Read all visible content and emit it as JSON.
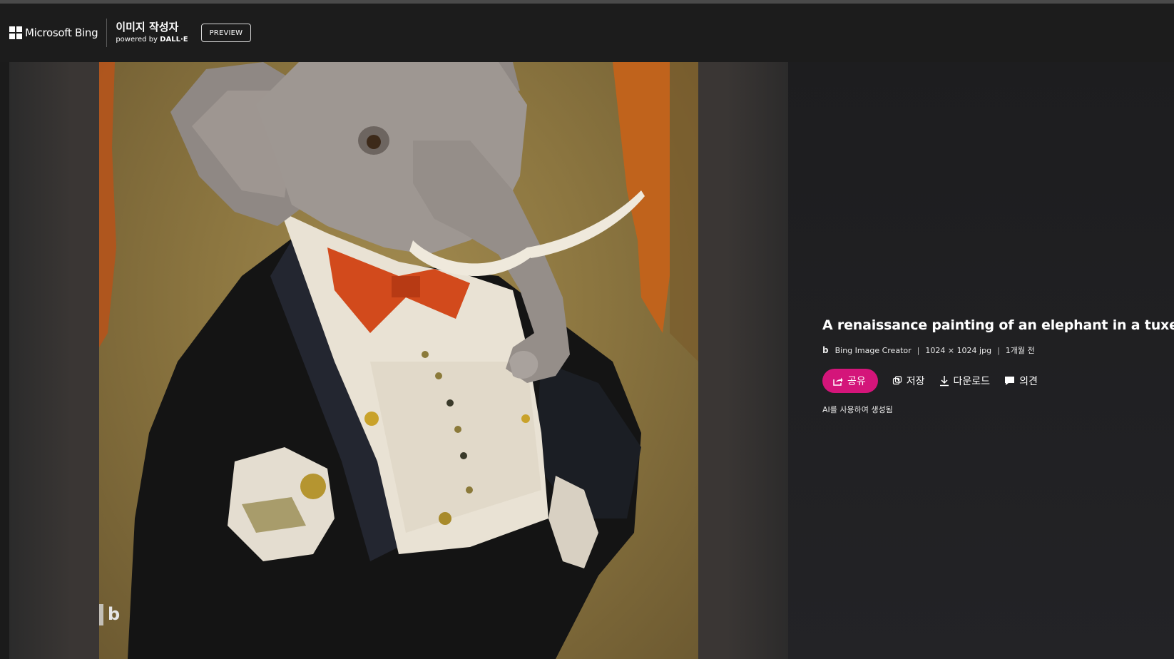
{
  "header": {
    "brand": "Microsoft Bing",
    "creator_title": "이미지 작성자",
    "powered_prefix": "powered by",
    "powered_name": "DALL·E",
    "preview_label": "PREVIEW"
  },
  "details": {
    "title": "A renaissance painting of an elephant in a tuxedo",
    "source": "Bing Image Creator",
    "size": "1024 × 1024 jpg",
    "age": "1개월 전",
    "ai_note": "AI를 사용하여 생성됨"
  },
  "actions": {
    "share": "공유",
    "save": "저장",
    "download": "다운로드",
    "feedback": "의견"
  },
  "image": {
    "watermark": "b"
  },
  "colors": {
    "accent": "#d4157a",
    "header_bg": "#1c1c1c",
    "panel_bg": "#1d1d1f"
  }
}
